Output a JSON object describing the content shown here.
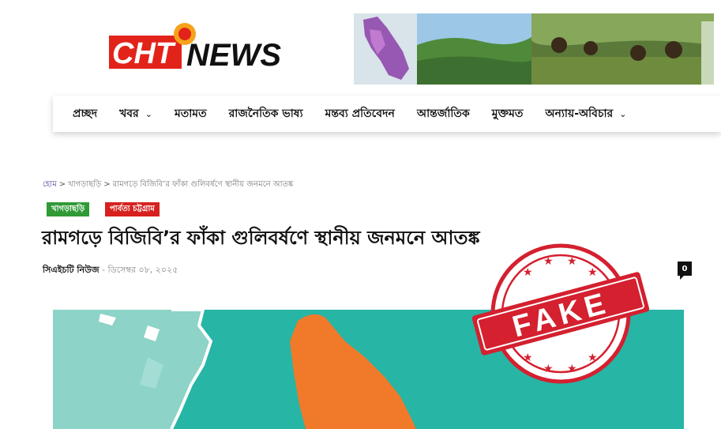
{
  "header": {
    "logo": {
      "part1": "CHT",
      "part2": "NEWS"
    }
  },
  "nav": {
    "items": [
      {
        "label": "প্রচ্ছদ",
        "dropdown": false
      },
      {
        "label": "খবর",
        "dropdown": true
      },
      {
        "label": "মতামত",
        "dropdown": false
      },
      {
        "label": "রাজনৈতিক ভাষ্য",
        "dropdown": false
      },
      {
        "label": "মন্তব্য প্রতিবেদন",
        "dropdown": false
      },
      {
        "label": "আন্তর্জাতিক",
        "dropdown": false
      },
      {
        "label": "মুক্তমত",
        "dropdown": false
      },
      {
        "label": "অন্যায়-অবিচার",
        "dropdown": true
      }
    ]
  },
  "breadcrumb": {
    "home": "হোম",
    "category": "খাগড়াছড়ি",
    "current": "রামগড়ে বিজিবি’র ফাঁকা গুলিবর্ষণে স্থানীয় জনমনে আতঙ্ক",
    "separator": ">"
  },
  "article": {
    "tags": [
      "খাগড়াছড়ি",
      "পার্বত্য চট্টগ্রাম"
    ],
    "title": "রামগড়ে বিজিবি’র ফাঁকা গুলিবর্ষণে স্থানীয় জনমনে আতঙ্ক",
    "author": "সিএইচটি নিউজ",
    "date_sep": " - ",
    "date": "ডিসেম্বর ০৮, ২০২৫",
    "comments": "0"
  },
  "stamp": {
    "text": "FAKE"
  },
  "colors": {
    "logo_red": "#e2231a",
    "tag_green": "#2f9a36",
    "tag_red": "#d7211f",
    "stamp_red": "#d4202f",
    "map_teal": "#27b5a6",
    "map_orange": "#f07a2a"
  }
}
